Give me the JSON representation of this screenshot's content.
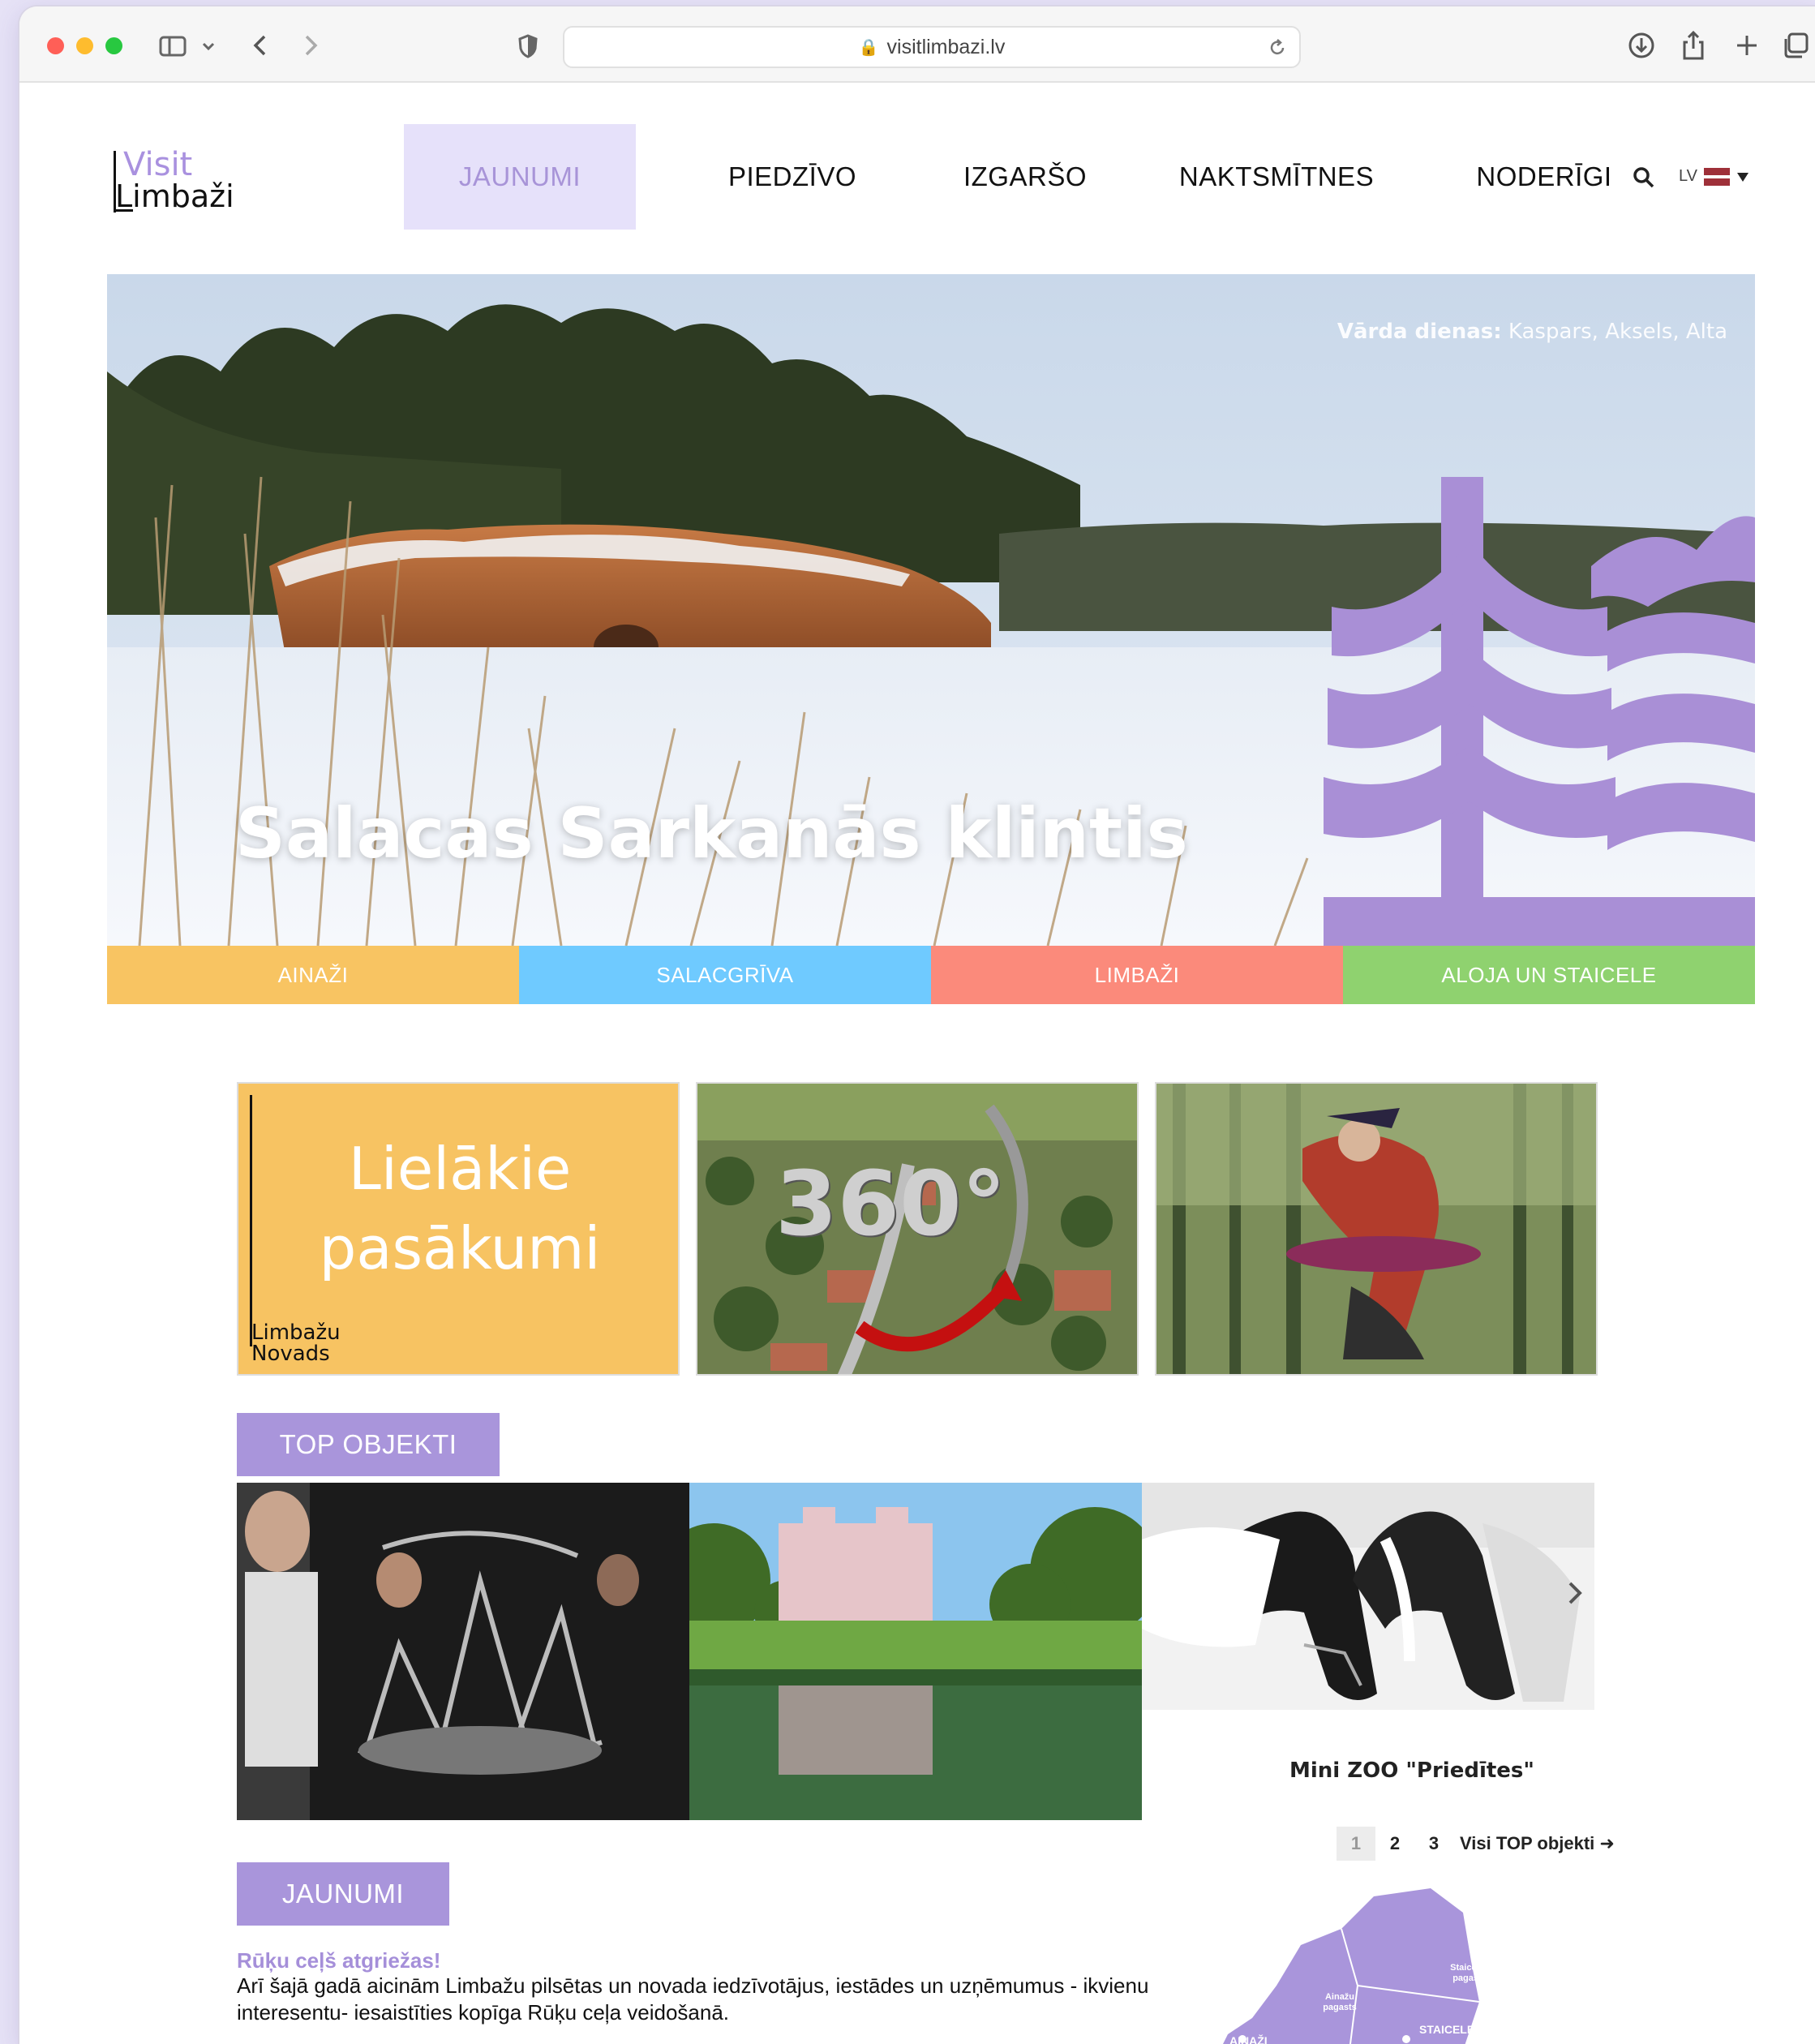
{
  "browser": {
    "url": "visitlimbazi.lv"
  },
  "site": {
    "logo_top": "Visit",
    "logo_bottom": "Limbaži",
    "nav": [
      {
        "label": "JAUNUMI"
      },
      {
        "label": "PIEDZĪVO"
      },
      {
        "label": "IZGARŠO"
      },
      {
        "label": "NAKTSMĪTNES"
      },
      {
        "label": "NODERĪGI"
      }
    ],
    "language": "LV"
  },
  "hero": {
    "name_days_label": "Vārda dienas:",
    "name_days_names": "Kaspars, Aksels, Alta",
    "title": "Salacas Sarkanās klintis"
  },
  "regions": [
    {
      "label": "AINAŽI",
      "color": "#f8c462"
    },
    {
      "label": "SALACGRĪVA",
      "color": "#6fcaff"
    },
    {
      "label": "LIMBAŽI",
      "color": "#fb8a7b"
    },
    {
      "label": "ALOJA UN STAICELE",
      "color": "#8fd26f"
    }
  ],
  "tiles": {
    "events_line1": "Lielākie",
    "events_line2": "pasākumi",
    "events_brand_top": "Limbažu",
    "events_brand_bottom": "Novads",
    "panorama_label": "360°"
  },
  "top_objects": {
    "heading": "TOP OBJEKTI",
    "third_caption": "Mini ZOO \"Priedītes\"",
    "pages": [
      "1",
      "2",
      "3"
    ],
    "all_link": "Visi TOP objekti ➜"
  },
  "news": {
    "heading": "JAUNUMI",
    "title": "Rūķu ceļš atgriežas!",
    "body": "Arī šajā gadā aicinām Limbažu pilsētas un novada iedzīvotājus, iestādes un uzņēmumus - ikvienu interesentu- iesaistīties kopīga Rūķu ceļa veidošanā."
  },
  "map": {
    "labels": [
      "Staiceles pagasts",
      "Ainažu pagasts",
      "AINAŽI",
      "STAICELE"
    ]
  },
  "colors": {
    "accent": "#a995db",
    "accent_light": "#e6e1fa"
  }
}
